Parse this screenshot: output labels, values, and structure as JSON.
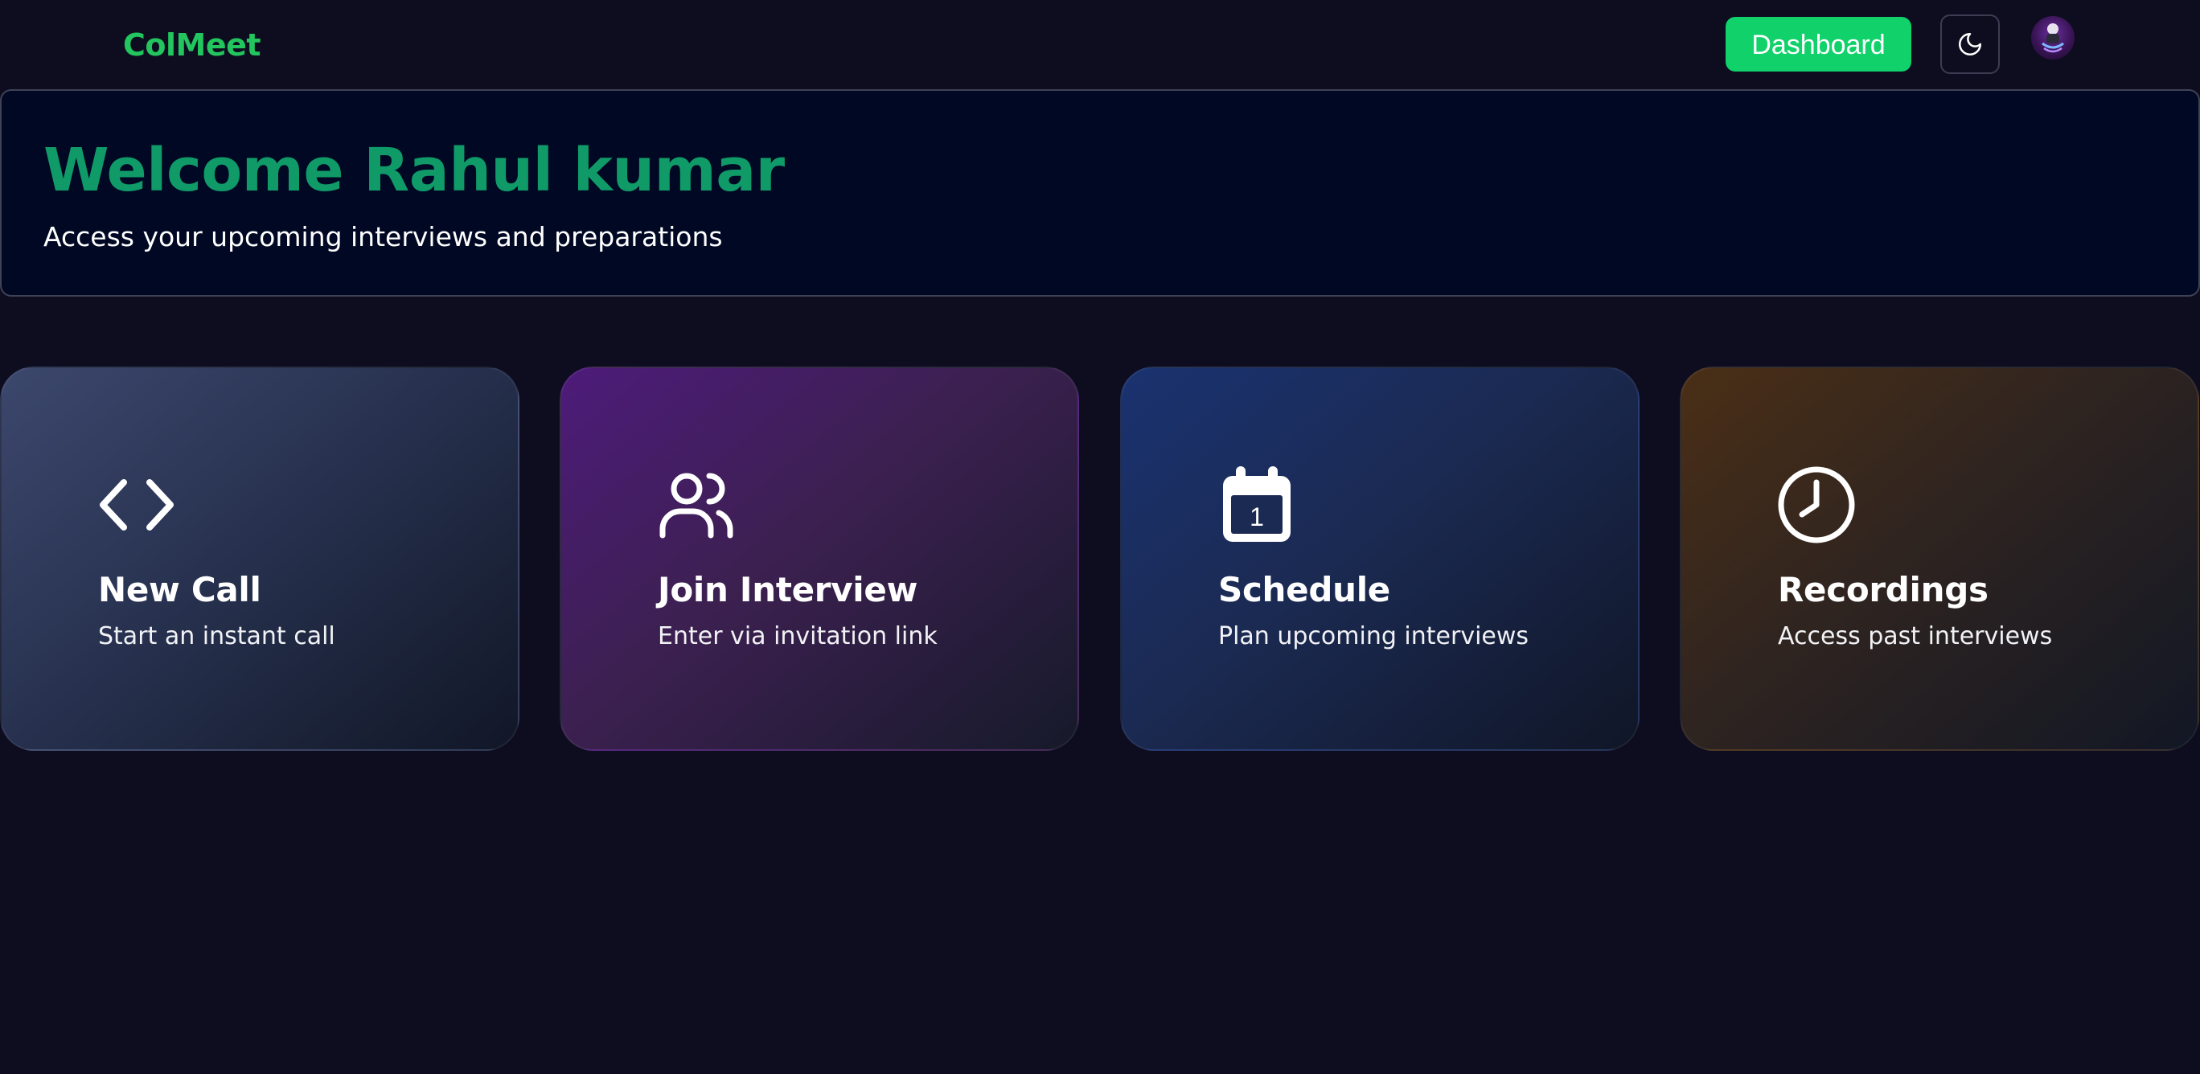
{
  "navbar": {
    "brand": "ColMeet",
    "dashboard_label": "Dashboard",
    "theme_icon": "moon-icon",
    "avatar_icon": "user-avatar"
  },
  "welcome": {
    "title": "Welcome Rahul kumar",
    "subtitle": "Access your upcoming interviews and preparations"
  },
  "cards": [
    {
      "title": "New Call",
      "description": "Start an instant call",
      "icon": "code-icon"
    },
    {
      "title": "Join Interview",
      "description": "Enter via invitation link",
      "icon": "users-icon"
    },
    {
      "title": "Schedule",
      "description": "Plan upcoming interviews",
      "icon": "calendar-icon",
      "icon_text": "1"
    },
    {
      "title": "Recordings",
      "description": "Access past interviews",
      "icon": "clock-icon"
    }
  ],
  "colors": {
    "background": "#0e0d20",
    "brand": "#22c55e",
    "dashboard_button": "#10d16a",
    "welcome_title": "#0f9a68",
    "welcome_panel": "#000824"
  }
}
